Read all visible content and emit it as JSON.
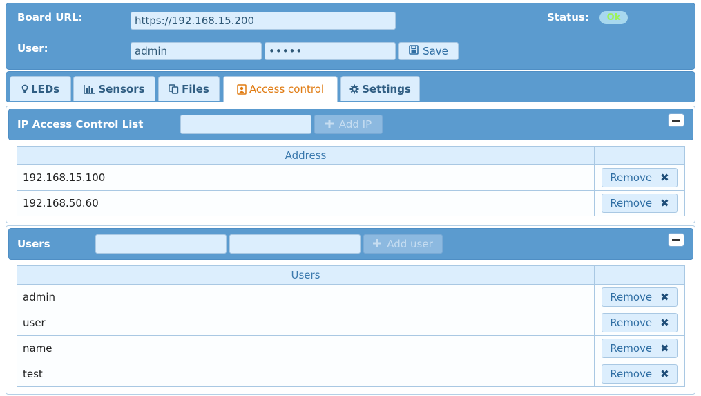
{
  "header": {
    "board_url_label": "Board URL:",
    "board_url_value": "https://192.168.15.200",
    "user_label": "User:",
    "user_value": "admin",
    "password_masked": "•••••",
    "save_label": "Save",
    "status_label": "Status:",
    "status_value": "Ok"
  },
  "tabs": [
    {
      "label": "LEDs",
      "icon": "lightbulb-icon",
      "active": false
    },
    {
      "label": "Sensors",
      "icon": "bar-chart-icon",
      "active": false
    },
    {
      "label": "Files",
      "icon": "copy-icon",
      "active": false
    },
    {
      "label": "Access control",
      "icon": "user-badge-icon",
      "active": true
    },
    {
      "label": "Settings",
      "icon": "gear-icon",
      "active": false
    }
  ],
  "ip_panel": {
    "title": "IP Access Control List",
    "add_label": "Add IP",
    "column_header": "Address",
    "rows": [
      "192.168.15.100",
      "192.168.50.60"
    ],
    "remove_label": "Remove"
  },
  "users_panel": {
    "title": "Users",
    "add_label": "Add user",
    "column_header": "Users",
    "rows": [
      "admin",
      "user",
      "name",
      "test"
    ],
    "remove_label": "Remove"
  },
  "colors": {
    "header_bg": "#5b9bcf",
    "field_bg": "#dceefd",
    "active_tab_text": "#e07b12",
    "status_ok_text": "#9cf25a"
  }
}
